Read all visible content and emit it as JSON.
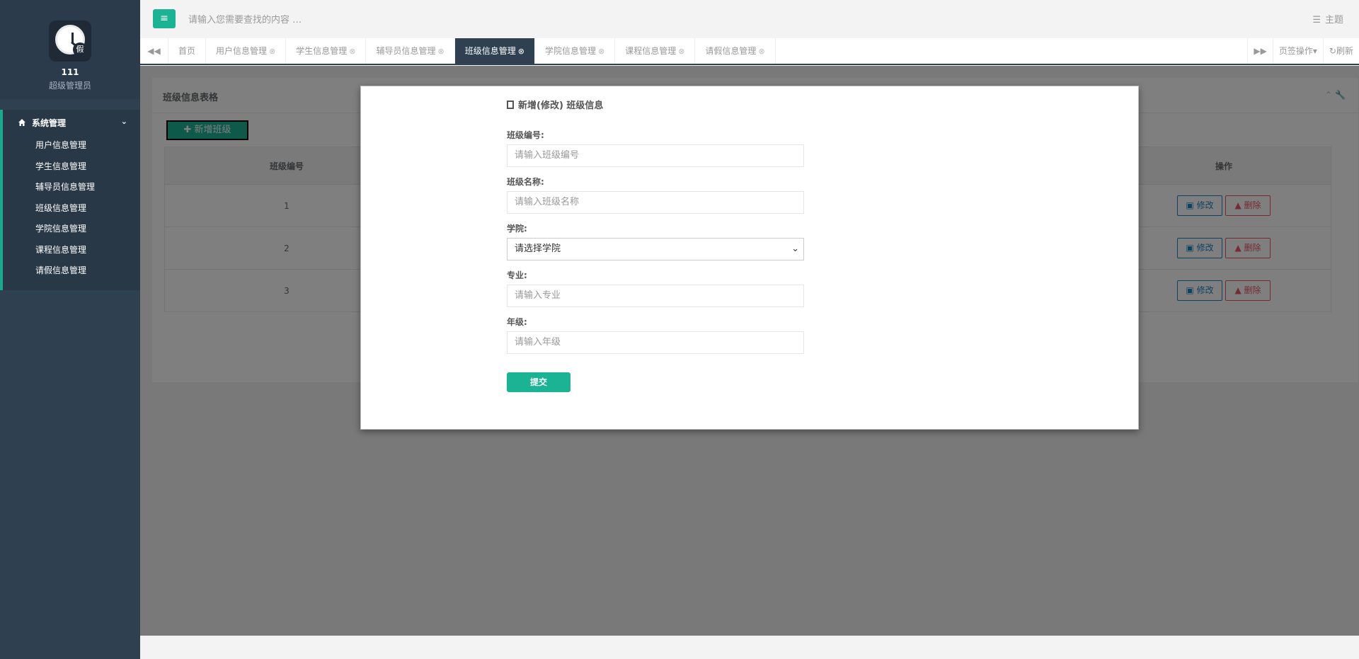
{
  "app": {
    "title": "班级信息管理"
  },
  "sidebar": {
    "user_name": "111",
    "user_role": "超级管理员",
    "logo_badge": "假",
    "section_label": "系统管理",
    "items": [
      {
        "label": "用户信息管理"
      },
      {
        "label": "学生信息管理"
      },
      {
        "label": "辅导员信息管理"
      },
      {
        "label": "班级信息管理"
      },
      {
        "label": "学院信息管理"
      },
      {
        "label": "课程信息管理"
      },
      {
        "label": "请假信息管理"
      }
    ]
  },
  "topbar": {
    "search_placeholder": "请输入您需要查找的内容 …",
    "theme_label": "主题"
  },
  "tabs": {
    "items": [
      {
        "label": "首页",
        "closable": false
      },
      {
        "label": "用户信息管理",
        "closable": true
      },
      {
        "label": "学生信息管理",
        "closable": true
      },
      {
        "label": "辅导员信息管理",
        "closable": true
      },
      {
        "label": "班级信息管理",
        "closable": true,
        "active": true
      },
      {
        "label": "学院信息管理",
        "closable": true
      },
      {
        "label": "课程信息管理",
        "closable": true
      },
      {
        "label": "请假信息管理",
        "closable": true
      }
    ],
    "page_ops_label": "页签操作",
    "refresh_label": "刷新"
  },
  "panel": {
    "title": "班级信息表格",
    "add_button": "✚ 新增班级",
    "columns": [
      "班级编号",
      "操作"
    ],
    "rows": [
      {
        "id": "1"
      },
      {
        "id": "2"
      },
      {
        "id": "3"
      }
    ],
    "edit_label": "修改",
    "delete_label": "删除"
  },
  "modal": {
    "title": "新增(修改) 班级信息",
    "fields": [
      {
        "label": "班级编号:",
        "placeholder": "请输入班级编号"
      },
      {
        "label": "班级名称:",
        "placeholder": "请输入班级名称"
      },
      {
        "label": "学院:",
        "value": "请选择学院"
      },
      {
        "label": "专业:",
        "placeholder": "请输入专业"
      },
      {
        "label": "年级:",
        "placeholder": "请输入年级"
      }
    ],
    "submit_label": "提交"
  },
  "colors": {
    "primary": "#1ab394",
    "sidebar": "#2f4050",
    "edit": "#1c84c6",
    "delete": "#ed5565"
  }
}
